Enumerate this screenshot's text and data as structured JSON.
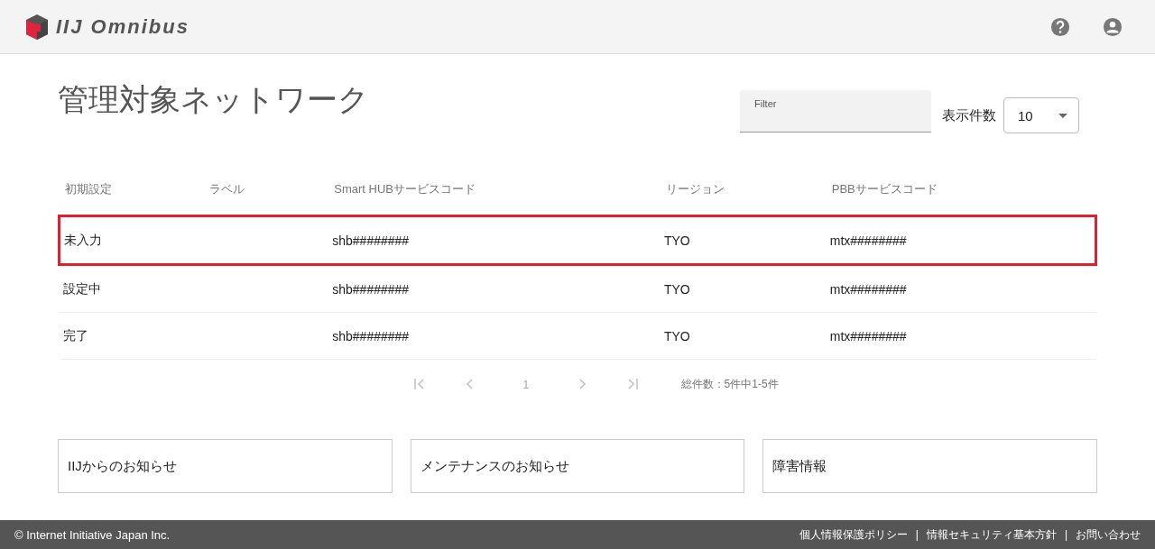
{
  "header": {
    "logo_text": "IIJ Omnibus"
  },
  "page": {
    "title": "管理対象ネットワーク"
  },
  "filter": {
    "label": "Filter"
  },
  "page_size": {
    "label": "表示件数",
    "value": "10"
  },
  "table": {
    "columns": [
      "初期設定",
      "ラベル",
      "Smart HUBサービスコード",
      "リージョン",
      "PBBサービスコード"
    ],
    "rows": [
      {
        "cells": [
          "未入力",
          "",
          "shb########",
          "TYO",
          "mtx########"
        ],
        "highlighted": true
      },
      {
        "cells": [
          "設定中",
          "",
          "shb########",
          "TYO",
          "mtx########"
        ],
        "highlighted": false
      },
      {
        "cells": [
          "完了",
          "",
          "shb########",
          "TYO",
          "mtx########"
        ],
        "highlighted": false
      }
    ]
  },
  "pagination": {
    "first_disabled": true,
    "prev_disabled": true,
    "page": "1",
    "next_disabled": true,
    "last_disabled": true,
    "summary": "総件数：5件中1-5件"
  },
  "notices": [
    "IIJからのお知らせ",
    "メンテナンスのお知らせ",
    "障害情報"
  ],
  "footer": {
    "copyright": "© Internet Initiative Japan Inc.",
    "links": [
      "個人情報保護ポリシー",
      "情報セキュリティ基本方針",
      "お問い合わせ"
    ],
    "separators": [
      "|",
      "|"
    ]
  }
}
